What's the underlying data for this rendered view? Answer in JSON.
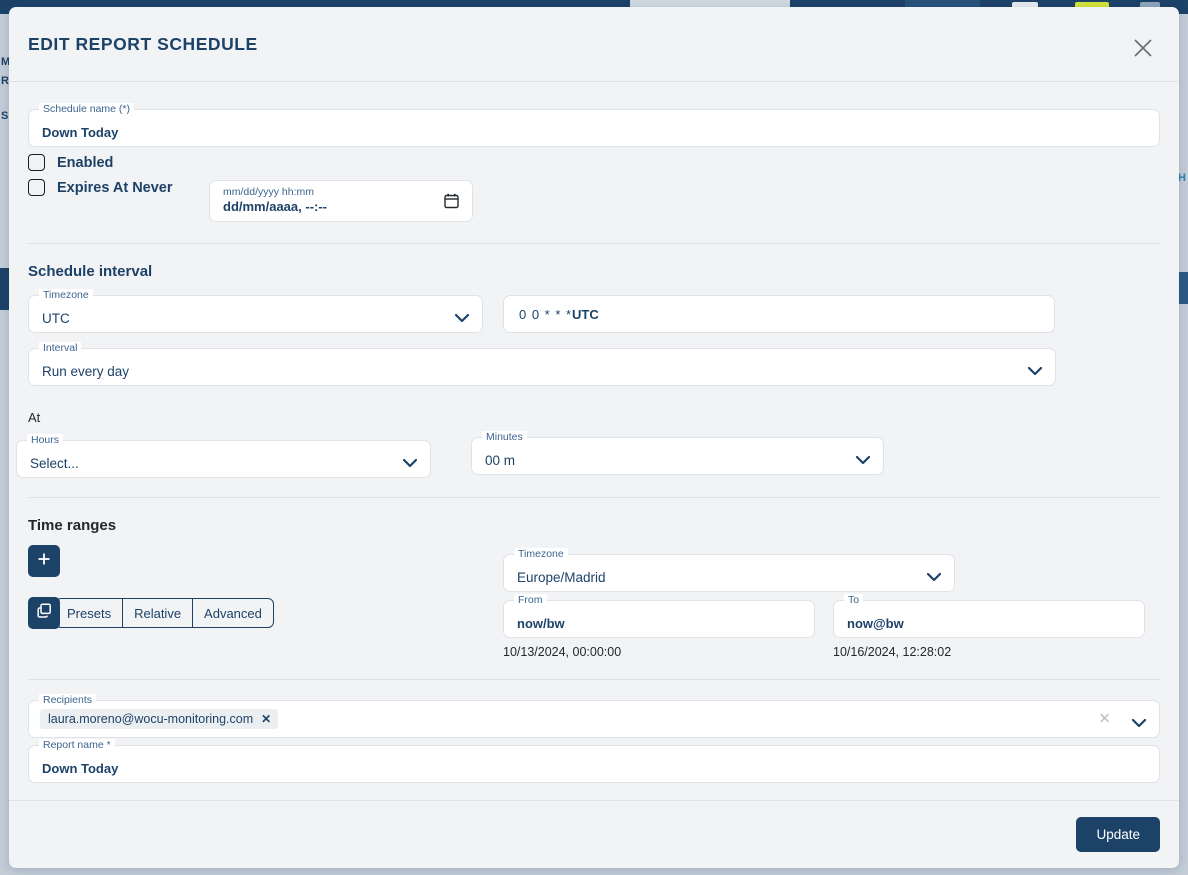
{
  "modal": {
    "title": "EDIT REPORT SCHEDULE",
    "close_icon": "close-icon",
    "footer": {
      "update_label": "Update"
    }
  },
  "schedule_name": {
    "legend": "Schedule name (*)",
    "value": "Down Today"
  },
  "toggles": {
    "enabled_label": "Enabled",
    "enabled_checked": false,
    "expires_label": "Expires At Never",
    "expires_checked": false
  },
  "expiry_date": {
    "placeholder": "mm/dd/yyyy hh:mm",
    "value": "dd/mm/aaaa, --:--",
    "calendar_icon": "calendar-icon"
  },
  "schedule_interval": {
    "heading": "Schedule interval",
    "timezone": {
      "legend": "Timezone",
      "value": "UTC"
    },
    "cron": {
      "expression": "0 0 * * *",
      "timezone_suffix": "UTC"
    },
    "interval": {
      "legend": "Interval",
      "value": "Run every day"
    },
    "at_label": "At",
    "hours": {
      "legend": "Hours",
      "value": "Select..."
    },
    "minutes": {
      "legend": "Minutes",
      "value": "00 m"
    }
  },
  "time_ranges": {
    "heading": "Time ranges",
    "add_icon": "plus-icon",
    "copy_icon": "copy-icon",
    "modes": [
      "Presets",
      "Relative",
      "Advanced"
    ],
    "timezone": {
      "legend": "Timezone",
      "value": "Europe/Madrid"
    },
    "from": {
      "legend": "From",
      "value": "now/bw",
      "resolved": "10/13/2024, 00:00:00"
    },
    "to": {
      "legend": "To",
      "value": "now@bw",
      "resolved": "10/16/2024, 12:28:02"
    }
  },
  "recipients": {
    "legend": "Recipients",
    "chips": [
      "laura.moreno@wocu-monitoring.com"
    ],
    "chip_remove_icon": "remove-chip-icon",
    "clear_icon": "clear-icon",
    "caret_icon": "chevron-down-icon"
  },
  "report_name": {
    "legend": "Report name *",
    "value": "Down Today"
  },
  "background": {
    "left_fragments": [
      "M",
      "R",
      "S"
    ],
    "right_fragment": "H"
  },
  "colors": {
    "brand_navy": "#1d4268",
    "modal_bg": "#f1f3f5",
    "page_bg": "#c5ced8",
    "field_border": "#dfe3e8"
  }
}
